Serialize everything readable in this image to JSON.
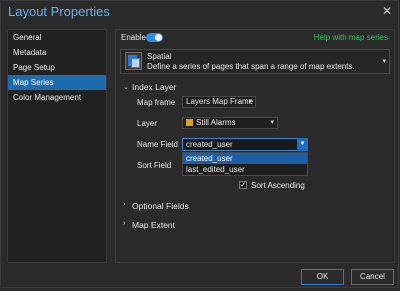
{
  "window": {
    "title": "Layout Properties"
  },
  "sidebar": {
    "items": [
      {
        "label": "General"
      },
      {
        "label": "Metadata"
      },
      {
        "label": "Page Setup"
      },
      {
        "label": "Map Series",
        "active": true
      },
      {
        "label": "Color Management"
      }
    ]
  },
  "header": {
    "enable_label": "Enable",
    "enable_on": true,
    "help_link": "Help with map series"
  },
  "series_type": {
    "name": "Spatial",
    "description": "Define a series of pages that span a range of map extents."
  },
  "index_layer": {
    "title": "Index Layer",
    "map_frame_label": "Map frame",
    "map_frame_value": "Layers Map Frame",
    "layer_label": "Layer",
    "layer_value": "Still Alarms",
    "name_field_label": "Name Field",
    "name_field_value": "created_user",
    "name_field_options": [
      "created_user",
      "last_edited_user"
    ],
    "sort_field_label": "Sort Field",
    "sort_ascending_label": "Sort Ascending",
    "sort_ascending_checked": true
  },
  "sections": {
    "optional_fields": "Optional Fields",
    "map_extent": "Map Extent"
  },
  "buttons": {
    "ok": "OK",
    "cancel": "Cancel"
  },
  "colors": {
    "accent": "#1d6cb0",
    "title": "#6ab0f0",
    "help_link": "#36c35c",
    "background": "#2b2b2b"
  }
}
